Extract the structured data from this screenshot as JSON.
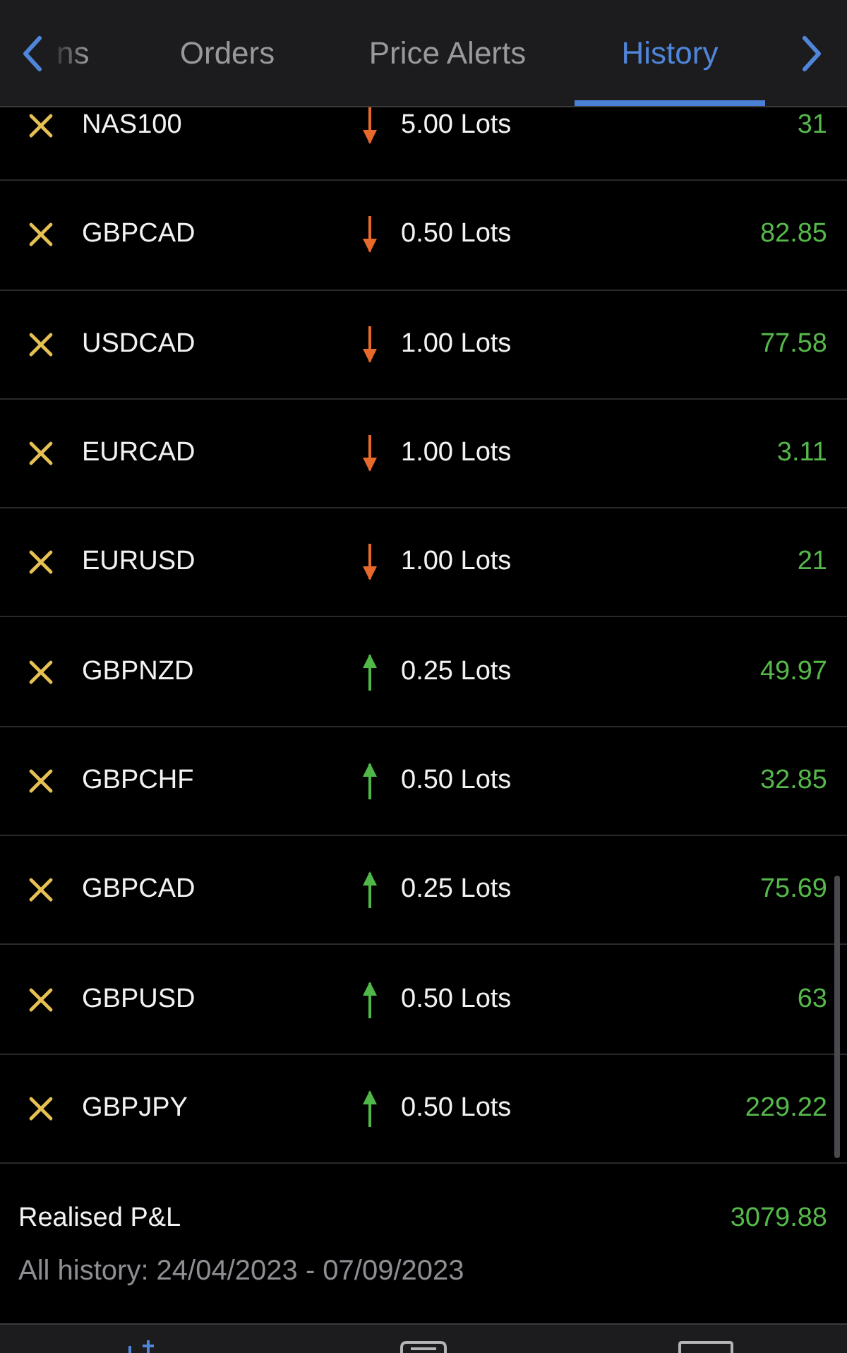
{
  "tabs": [
    {
      "label": "ns",
      "selected": false,
      "kind": "partial"
    },
    {
      "label": "Orders",
      "selected": false,
      "kind": "full"
    },
    {
      "label": "Price Alerts",
      "selected": false,
      "kind": "full"
    },
    {
      "label": "History",
      "selected": true,
      "kind": "full"
    }
  ],
  "trades": [
    {
      "symbol": "NAS100",
      "kind": "down",
      "lots": "5.00 Lots",
      "profit": "31"
    },
    {
      "symbol": "GBPCAD",
      "kind": "down",
      "lots": "0.50 Lots",
      "profit": "82.85"
    },
    {
      "symbol": "USDCAD",
      "kind": "down",
      "lots": "1.00 Lots",
      "profit": "77.58"
    },
    {
      "symbol": "EURCAD",
      "kind": "down",
      "lots": "1.00 Lots",
      "profit": "3.11"
    },
    {
      "symbol": "EURUSD",
      "kind": "down",
      "lots": "1.00 Lots",
      "profit": "21"
    },
    {
      "symbol": "GBPNZD",
      "kind": "up",
      "lots": "0.25 Lots",
      "profit": "49.97"
    },
    {
      "symbol": "GBPCHF",
      "kind": "up",
      "lots": "0.50 Lots",
      "profit": "32.85"
    },
    {
      "symbol": "GBPCAD",
      "kind": "up",
      "lots": "0.25 Lots",
      "profit": "75.69"
    },
    {
      "symbol": "GBPUSD",
      "kind": "up",
      "lots": "0.50 Lots",
      "profit": "63"
    },
    {
      "symbol": "GBPJPY",
      "kind": "up",
      "lots": "0.50 Lots",
      "profit": "229.22"
    }
  ],
  "summary": {
    "label": "Realised P&L",
    "value": "3079.88",
    "range": "All history: 24/04/2023 - 07/09/2023"
  }
}
